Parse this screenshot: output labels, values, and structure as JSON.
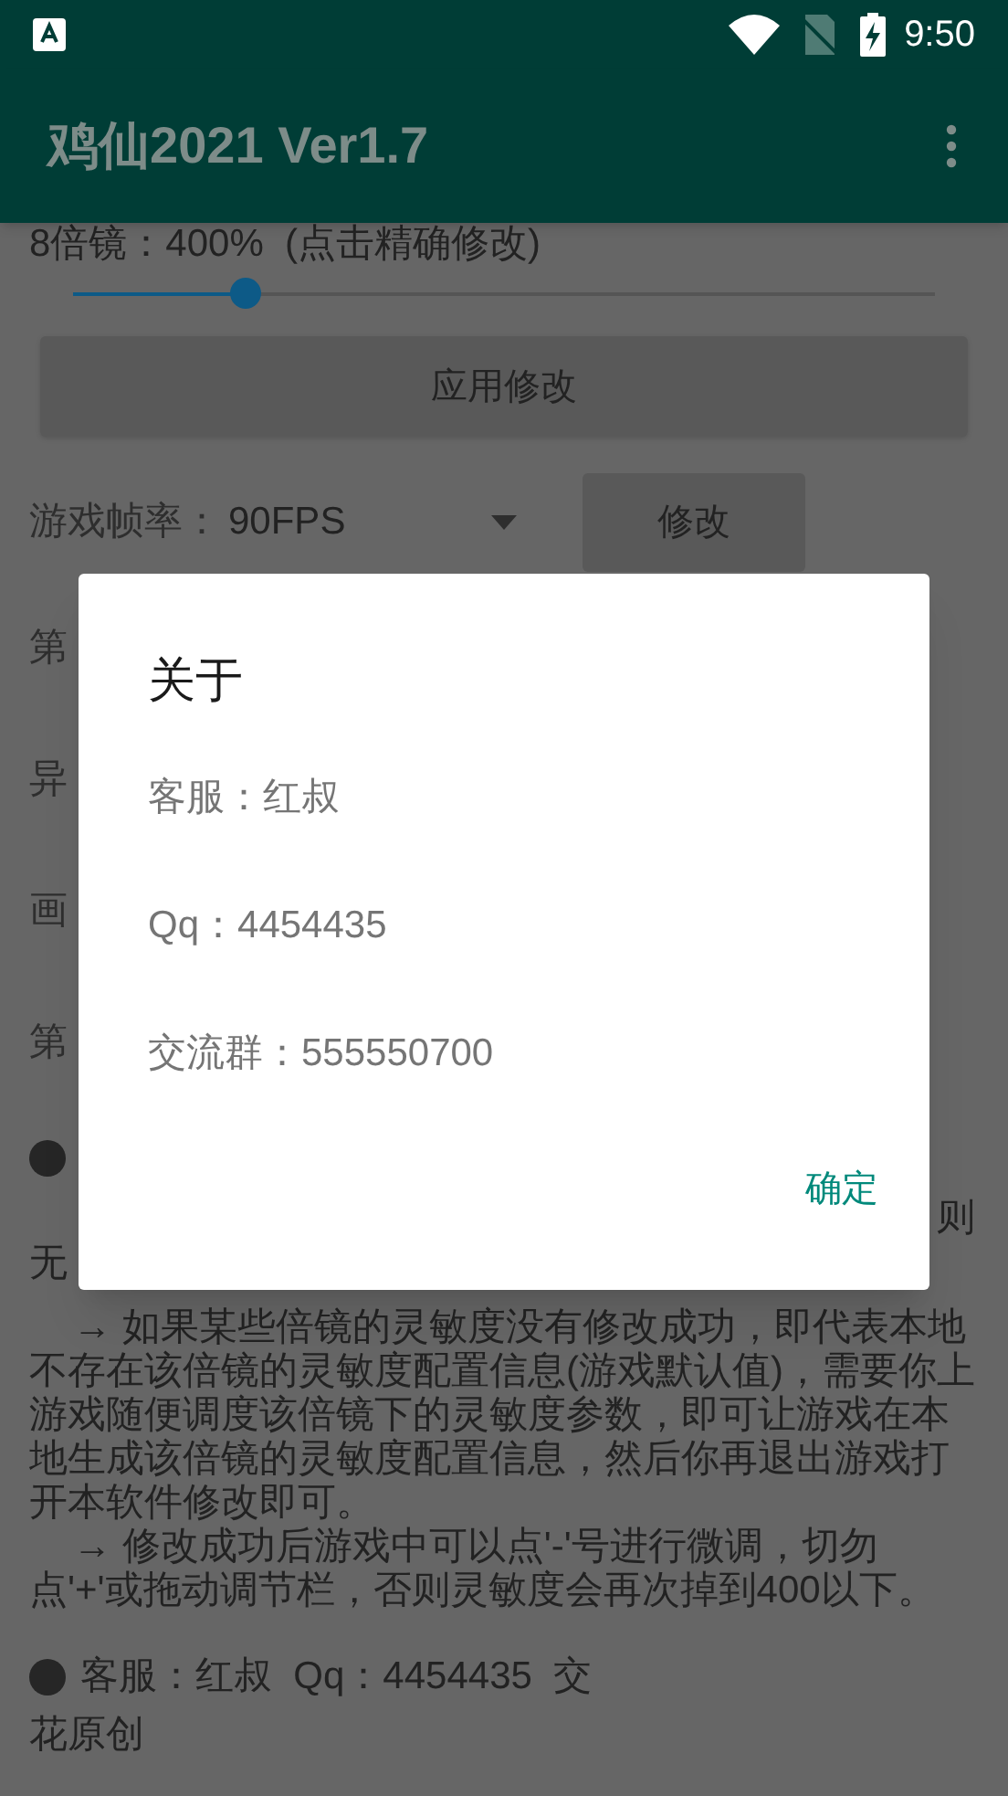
{
  "status_bar": {
    "time": "9:50"
  },
  "app_bar": {
    "title": "鸡仙2021 Ver1.7"
  },
  "scope": {
    "label": "8倍镜：400%  (点击精确修改)",
    "level": 0.2
  },
  "apply_button": "应用修改",
  "fps": {
    "label": "游戏帧率：",
    "value": "90FPS",
    "button": "修改"
  },
  "setting_rows": [
    "第",
    "异",
    "画",
    "第"
  ],
  "notes": [
    {
      "kind": "bullet"
    },
    {
      "kind": "tail",
      "text": "则"
    },
    {
      "kind": "line",
      "text": "无"
    },
    {
      "kind": "paragraph",
      "text": "→ 如果某些倍镜的灵敏度没有修改成功，即代表本地不存在该倍镜的灵敏度配置信息(游戏默认值)，需要你上游戏随便调度该倍镜下的灵敏度参数，即可让游戏在本地生成该倍镜的灵敏度配置信息，然后你再退出游戏打开本软件修改即可。"
    },
    {
      "kind": "paragraph",
      "text": "→ 修改成功后游戏中可以点'-'号进行微调，切勿点'+'或拖动调节栏，否则灵敏度会再次掉到400以下。"
    },
    {
      "kind": "bullet",
      "text": "客服：红叔  Qq：4454435  交"
    },
    {
      "kind": "line",
      "text": "花原创"
    }
  ],
  "dialog": {
    "title": "关于",
    "lines": [
      "客服：红叔",
      "Qq：4454435",
      "交流群：555550700"
    ],
    "button": "确定"
  }
}
